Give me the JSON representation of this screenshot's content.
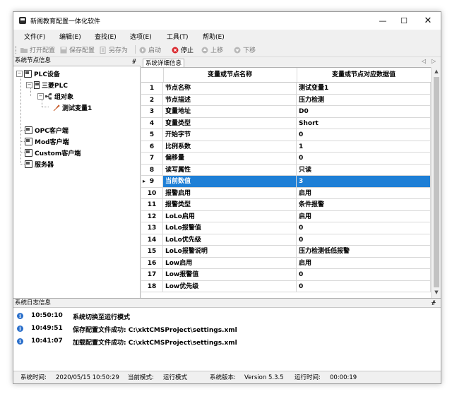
{
  "window": {
    "title": "新阁教育配置一体化软件"
  },
  "menu": [
    "文件(F)",
    "编辑(E)",
    "查找(E)",
    "选项(E)",
    "工具(T)",
    "帮助(E)"
  ],
  "toolbar": {
    "open": "打开配置",
    "save": "保存配置",
    "save_as": "另存为",
    "start": "启动",
    "stop": "停止",
    "up": "上移",
    "down": "下移"
  },
  "left_panel": {
    "title": "系统节点信息",
    "pin": "ᚌ",
    "tree": {
      "plc_device": "PLC设备",
      "mitsubishi_plc": "三菱PLC",
      "group": "组对象",
      "test_var": "测试变量1",
      "opc_client": "OPC客户端",
      "mod_client": "Mod客户端",
      "custom_client": "Custom客户端",
      "server": "服务器"
    }
  },
  "detail_tab": {
    "label": "系统详细信息",
    "nav_left": "◁",
    "nav_right": "▷"
  },
  "grid": {
    "headers": [
      "变量或节点名称",
      "变量或节点对应数据值"
    ],
    "rows": [
      {
        "idx": "1",
        "name": "节点名称",
        "value": "测试变量1"
      },
      {
        "idx": "2",
        "name": "节点描述",
        "value": "压力检测"
      },
      {
        "idx": "3",
        "name": "变量地址",
        "value": "D0"
      },
      {
        "idx": "4",
        "name": "变量类型",
        "value": "Short"
      },
      {
        "idx": "5",
        "name": "开始字节",
        "value": "0"
      },
      {
        "idx": "6",
        "name": "比例系数",
        "value": "1"
      },
      {
        "idx": "7",
        "name": "偏移量",
        "value": "0"
      },
      {
        "idx": "8",
        "name": "读写属性",
        "value": "只读"
      },
      {
        "idx": "9",
        "name": "当前数值",
        "value": "3",
        "selected": true,
        "marker": "▸"
      },
      {
        "idx": "10",
        "name": "报警启用",
        "value": "启用"
      },
      {
        "idx": "11",
        "name": "报警类型",
        "value": "条件报警"
      },
      {
        "idx": "12",
        "name": "LoLo启用",
        "value": "启用"
      },
      {
        "idx": "13",
        "name": "LoLo报警值",
        "value": "0"
      },
      {
        "idx": "14",
        "name": "LoLo优先级",
        "value": "0"
      },
      {
        "idx": "15",
        "name": "LoLo报警说明",
        "value": "压力检测低低报警"
      },
      {
        "idx": "16",
        "name": "Low启用",
        "value": "启用"
      },
      {
        "idx": "17",
        "name": "Low报警值",
        "value": "0"
      },
      {
        "idx": "18",
        "name": "Low优先级",
        "value": "0"
      }
    ]
  },
  "log_panel": {
    "title": "系统日志信息",
    "pin": "ᚌ",
    "entries": [
      {
        "time": "10:50:10",
        "msg": "系统切换至运行模式"
      },
      {
        "time": "10:49:51",
        "msg": "保存配置文件成功:  C:\\xktCMSProject\\settings.xml"
      },
      {
        "time": "10:41:07",
        "msg": "加载配置文件成功:  C:\\xktCMSProject\\settings.xml"
      }
    ]
  },
  "status": {
    "sys_time_label": "系统时间:",
    "sys_time": "2020/05/15 10:50:29",
    "mode_label": "当前模式:",
    "mode": "运行模式",
    "version_label": "系统版本:",
    "version": "Version  5.3.5",
    "runtime_label": "运行时间:",
    "runtime": "00:00:19"
  },
  "colors": {
    "selection": "#1e7fd6",
    "stop_icon": "#d9262c",
    "info_icon": "#2a6fcb"
  }
}
